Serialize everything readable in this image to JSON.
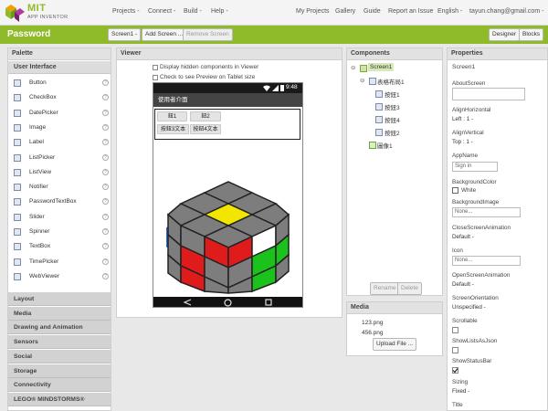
{
  "header": {
    "logo_title": "MIT",
    "logo_subtitle": "APP INVENTOR",
    "nav_left": [
      "Projects -",
      "Connect -",
      "Build -",
      "Help -"
    ],
    "nav_right": [
      "My Projects",
      "Gallery",
      "Guide",
      "Report an Issue",
      "English -",
      "tayun.chang@gmail.com -"
    ]
  },
  "toolbar": {
    "project_name": "Password",
    "screen_select": "Screen1 -",
    "add_screen": "Add Screen ...",
    "remove_screen": "Remove Screen",
    "designer": "Designer",
    "blocks": "Blocks"
  },
  "palette": {
    "title": "Palette",
    "open_category": "User Interface",
    "items": [
      {
        "label": "Button",
        "icon": "button-icon"
      },
      {
        "label": "CheckBox",
        "icon": "checkbox-icon"
      },
      {
        "label": "DatePicker",
        "icon": "datepicker-icon"
      },
      {
        "label": "Image",
        "icon": "image-icon"
      },
      {
        "label": "Label",
        "icon": "label-icon"
      },
      {
        "label": "ListPicker",
        "icon": "listpicker-icon"
      },
      {
        "label": "ListView",
        "icon": "listview-icon"
      },
      {
        "label": "Notifier",
        "icon": "notifier-icon"
      },
      {
        "label": "PasswordTextBox",
        "icon": "passwordtextbox-icon"
      },
      {
        "label": "Slider",
        "icon": "slider-icon"
      },
      {
        "label": "Spinner",
        "icon": "spinner-icon"
      },
      {
        "label": "TextBox",
        "icon": "textbox-icon"
      },
      {
        "label": "TimePicker",
        "icon": "timepicker-icon"
      },
      {
        "label": "WebViewer",
        "icon": "webviewer-icon"
      }
    ],
    "help_glyph": "?",
    "categories": [
      "Layout",
      "Media",
      "Drawing and Animation",
      "Sensors",
      "Social",
      "Storage",
      "Connectivity",
      "LEGO® MINDSTORMS®"
    ]
  },
  "viewer": {
    "title": "Viewer",
    "check_hidden": "Display hidden components in Viewer",
    "check_tablet": "Check to see Preview on Tablet size",
    "phone": {
      "clock": "9:48",
      "title": "使用者介面",
      "button1": "鈕1",
      "button2": "鈕2",
      "button3": "按鈕3文本",
      "button4": "按鈕4文本"
    }
  },
  "components": {
    "title": "Components",
    "tree": {
      "screen": "Screen1",
      "table": "表格布局1",
      "buttons": [
        "按鈕1",
        "按鈕3",
        "按鈕4",
        "按鈕2"
      ],
      "image": "圖像1"
    },
    "rename": "Rename",
    "delete": "Delete"
  },
  "media": {
    "title": "Media",
    "files": [
      "123.png",
      "456.png"
    ],
    "upload": "Upload File ..."
  },
  "properties": {
    "title": "Properties",
    "component": "Screen1",
    "items": {
      "about_screen": {
        "label": "AboutScreen",
        "value": ""
      },
      "align_horizontal": {
        "label": "AlignHorizontal",
        "value": "Left : 1 -"
      },
      "align_vertical": {
        "label": "AlignVertical",
        "value": "Top : 1 -"
      },
      "app_name": {
        "label": "AppName",
        "value": "Sign in"
      },
      "background_color": {
        "label": "BackgroundColor",
        "value": "White",
        "color": "#ffffff"
      },
      "background_image": {
        "label": "BackgroundImage",
        "value": "None..."
      },
      "close_screen_animation": {
        "label": "CloseScreenAnimation",
        "value": "Default -"
      },
      "icon": {
        "label": "Icon",
        "value": "None..."
      },
      "open_screen_animation": {
        "label": "OpenScreenAnimation",
        "value": "Default -"
      },
      "screen_orientation": {
        "label": "ScreenOrientation",
        "value": "Unspecified -"
      },
      "scrollable": {
        "label": "Scrollable",
        "checked": false
      },
      "show_lists_as_json": {
        "label": "ShowListsAsJson",
        "checked": false
      },
      "show_status_bar": {
        "label": "ShowStatusBar",
        "checked": true
      },
      "sizing": {
        "label": "Sizing",
        "value": "Fixed -"
      },
      "title": {
        "label": "Title",
        "value": ""
      }
    }
  },
  "colors": {
    "accent": "#8fbb2b",
    "cube_red": "#e01b1b",
    "cube_green": "#1cc21c",
    "cube_yellow": "#f2e600",
    "cube_gray": "#7d7d7d"
  }
}
